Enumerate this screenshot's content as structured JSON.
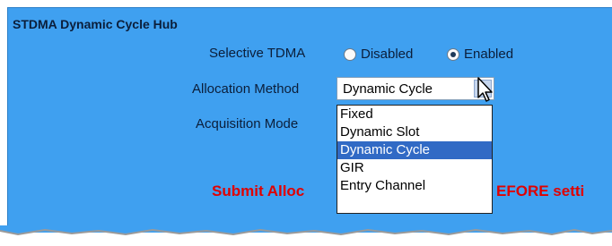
{
  "panel": {
    "title": "STDMA Dynamic Cycle Hub"
  },
  "selective_tdma": {
    "label": "Selective TDMA",
    "options": [
      {
        "label": "Disabled",
        "selected": false
      },
      {
        "label": "Enabled",
        "selected": true
      }
    ]
  },
  "allocation_method": {
    "label": "Allocation Method",
    "value": "Dynamic Cycle",
    "options": [
      "Fixed",
      "Dynamic Slot",
      "Dynamic Cycle",
      "GIR",
      "Entry Channel"
    ],
    "highlighted": "Dynamic Cycle"
  },
  "acquisition_mode": {
    "label": "Acquisition Mode"
  },
  "warning": {
    "left": "Submit Alloc",
    "right": "EFORE setti"
  },
  "colors": {
    "panel_bg": "#3fa0f0",
    "warning": "#e00000",
    "highlight": "#316ac5"
  }
}
